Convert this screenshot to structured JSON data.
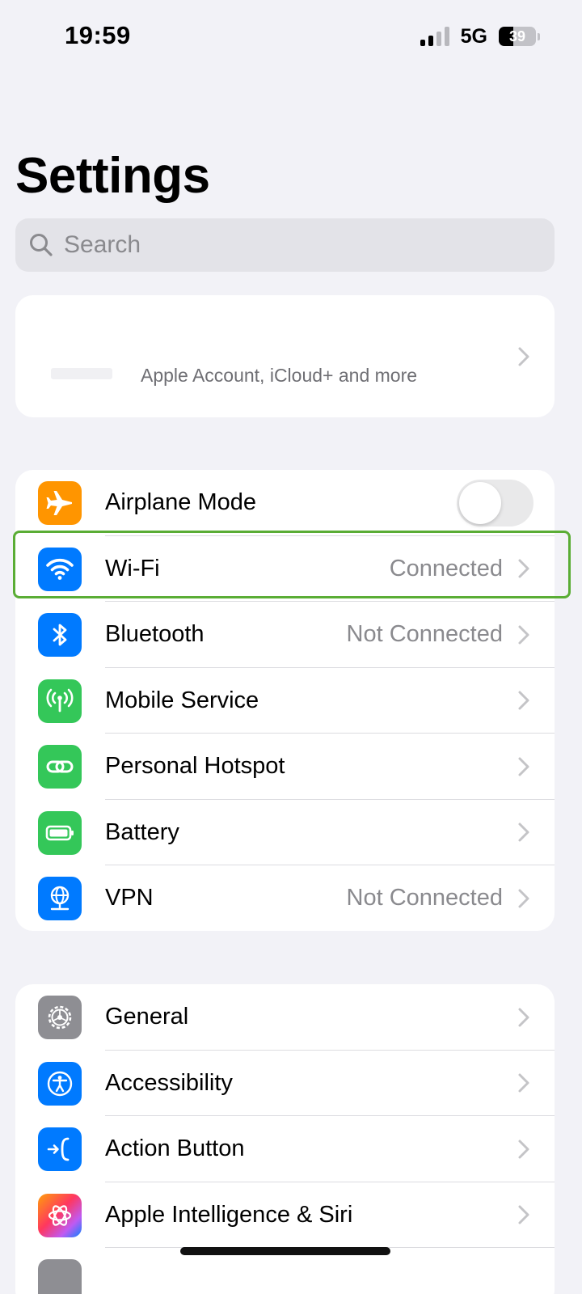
{
  "status_bar": {
    "time": "19:59",
    "network": "5G",
    "battery_percent": "39",
    "battery_level": 0.39,
    "signal_bars_active": 2,
    "signal_bars_total": 4
  },
  "header": {
    "title": "Settings"
  },
  "search": {
    "placeholder": "Search",
    "value": ""
  },
  "account": {
    "subtitle": "Apple Account, iCloud+ and more"
  },
  "network_section": {
    "airplane_mode": {
      "label": "Airplane Mode",
      "icon": "airplane-icon",
      "color": "#ff9500",
      "enabled": false
    },
    "wifi": {
      "label": "Wi-Fi",
      "value": "Connected",
      "icon": "wifi-icon",
      "color": "#007aff",
      "highlighted": true
    },
    "bluetooth": {
      "label": "Bluetooth",
      "value": "Not Connected",
      "icon": "bluetooth-icon",
      "color": "#007aff"
    },
    "mobile_service": {
      "label": "Mobile Service",
      "icon": "antenna-icon",
      "color": "#34c759"
    },
    "personal_hotspot": {
      "label": "Personal Hotspot",
      "icon": "link-icon",
      "color": "#34c759"
    },
    "battery": {
      "label": "Battery",
      "icon": "battery-icon",
      "color": "#34c759"
    },
    "vpn": {
      "label": "VPN",
      "value": "Not Connected",
      "icon": "globe-icon",
      "color": "#007aff"
    }
  },
  "general_section": {
    "general": {
      "label": "General",
      "icon": "gear-icon",
      "color": "#8e8e93"
    },
    "accessibility": {
      "label": "Accessibility",
      "icon": "accessibility-icon",
      "color": "#007aff"
    },
    "action_button": {
      "label": "Action Button",
      "icon": "action-button-icon",
      "color": "#007aff"
    },
    "apple_intelligence": {
      "label": "Apple Intelligence & Siri",
      "icon": "apple-intelligence-icon",
      "color": "#ff5e8a"
    }
  },
  "highlight_color": "#5aad35"
}
